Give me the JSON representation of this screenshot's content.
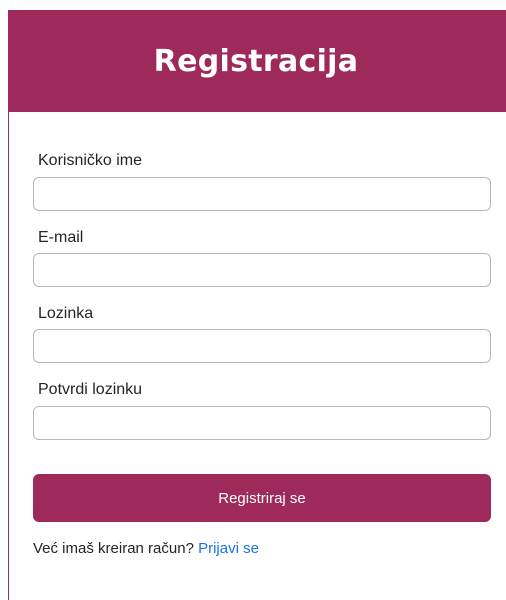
{
  "header": {
    "title": "Registracija"
  },
  "form": {
    "username_label": "Korisničko ime",
    "username_value": "",
    "email_label": "E-mail",
    "email_value": "",
    "password_label": "Lozinka",
    "password_value": "",
    "confirm_password_label": "Potvrdi lozinku",
    "confirm_password_value": "",
    "submit_label": "Registriraj se"
  },
  "footer": {
    "prompt_text": "Već imaš kreiran račun?",
    "login_link": "Prijavi se"
  },
  "colors": {
    "brand": "#9d2a5b",
    "link": "#1a73e8"
  }
}
